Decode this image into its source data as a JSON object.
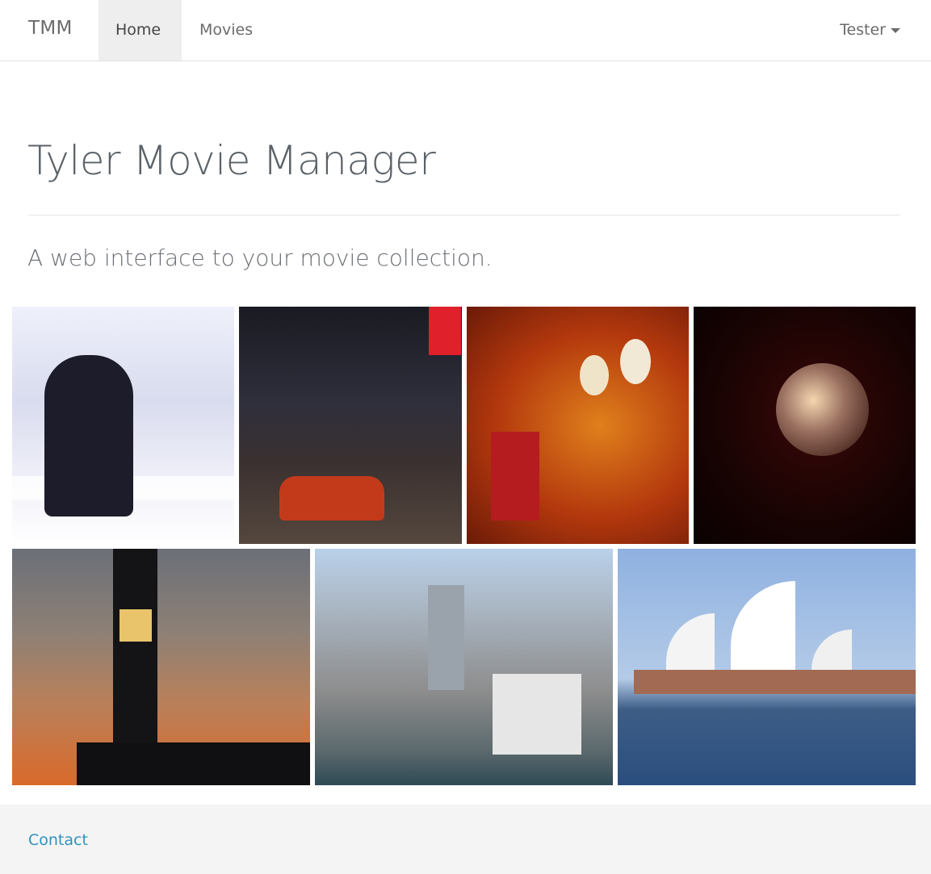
{
  "navbar": {
    "brand": "TMM",
    "items": [
      {
        "label": "Home",
        "active": true
      },
      {
        "label": "Movies",
        "active": false
      }
    ],
    "user": "Tester"
  },
  "hero": {
    "title": "Tyler Movie Manager",
    "lead": "A web interface to your movie collection."
  },
  "gallery": {
    "photos": [
      "bartender-photo",
      "city-street-night-photo",
      "bar-wall-signs-photo",
      "disco-ball-photo",
      "empire-state-building-photo",
      "city-aerial-photo",
      "sydney-opera-house-photo"
    ]
  },
  "footer": {
    "contact_label": "Contact"
  },
  "colors": {
    "link": "#2f92bf",
    "nav_active_bg": "#eeeeee",
    "footer_bg": "#f4f4f4"
  }
}
